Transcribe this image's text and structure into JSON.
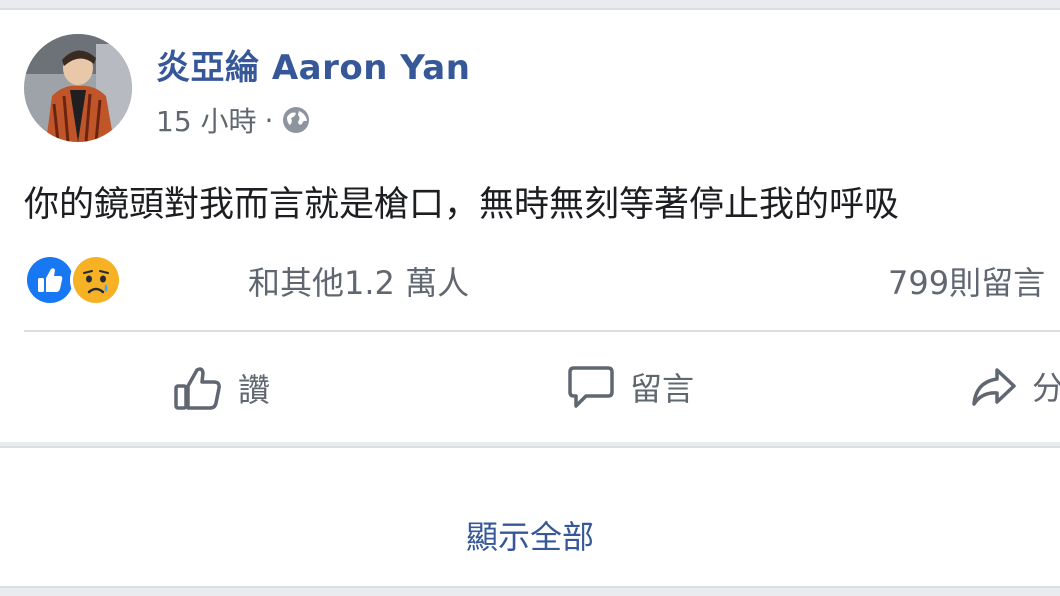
{
  "post": {
    "author": "炎亞綸 Aaron Yan",
    "time": "15 小時",
    "separator": "·",
    "text": "你的鏡頭對我而言就是槍口，無時無刻等著停止我的呼吸"
  },
  "reactions": {
    "icons": [
      "like-icon",
      "sad-icon"
    ],
    "names_text": "和其他1.2 萬人",
    "comments_text": "799則留言"
  },
  "actions": {
    "like_label": "讚",
    "comment_label": "留言",
    "share_label": "分"
  },
  "footer": {
    "show_all_label": "顯示全部"
  },
  "colors": {
    "link_blue": "#365899",
    "like_blue": "#1877f2",
    "sad_yellow": "#f7b125",
    "text_gray": "#606770"
  }
}
